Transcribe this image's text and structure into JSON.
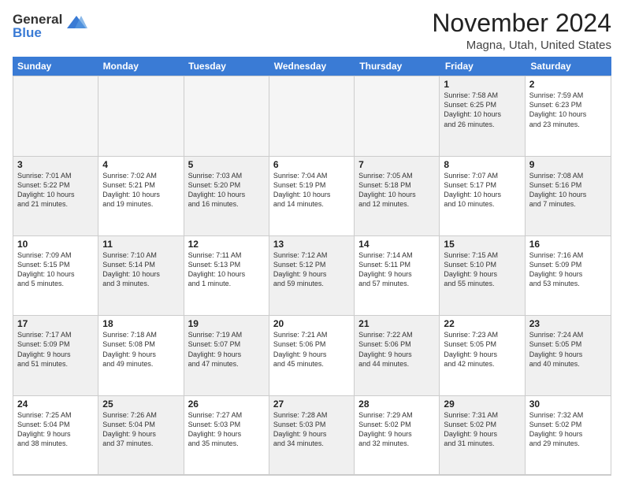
{
  "header": {
    "logo_line1": "General",
    "logo_line2": "Blue",
    "month_title": "November 2024",
    "location": "Magna, Utah, United States"
  },
  "weekdays": [
    "Sunday",
    "Monday",
    "Tuesday",
    "Wednesday",
    "Thursday",
    "Friday",
    "Saturday"
  ],
  "weeks": [
    [
      {
        "day": "",
        "detail": "",
        "empty": true
      },
      {
        "day": "",
        "detail": "",
        "empty": true
      },
      {
        "day": "",
        "detail": "",
        "empty": true
      },
      {
        "day": "",
        "detail": "",
        "empty": true
      },
      {
        "day": "",
        "detail": "",
        "empty": true
      },
      {
        "day": "1",
        "detail": "Sunrise: 7:58 AM\nSunset: 6:25 PM\nDaylight: 10 hours\nand 26 minutes.",
        "shaded": true
      },
      {
        "day": "2",
        "detail": "Sunrise: 7:59 AM\nSunset: 6:23 PM\nDaylight: 10 hours\nand 23 minutes.",
        "shaded": false
      }
    ],
    [
      {
        "day": "3",
        "detail": "Sunrise: 7:01 AM\nSunset: 5:22 PM\nDaylight: 10 hours\nand 21 minutes.",
        "shaded": true
      },
      {
        "day": "4",
        "detail": "Sunrise: 7:02 AM\nSunset: 5:21 PM\nDaylight: 10 hours\nand 19 minutes.",
        "shaded": false
      },
      {
        "day": "5",
        "detail": "Sunrise: 7:03 AM\nSunset: 5:20 PM\nDaylight: 10 hours\nand 16 minutes.",
        "shaded": true
      },
      {
        "day": "6",
        "detail": "Sunrise: 7:04 AM\nSunset: 5:19 PM\nDaylight: 10 hours\nand 14 minutes.",
        "shaded": false
      },
      {
        "day": "7",
        "detail": "Sunrise: 7:05 AM\nSunset: 5:18 PM\nDaylight: 10 hours\nand 12 minutes.",
        "shaded": true
      },
      {
        "day": "8",
        "detail": "Sunrise: 7:07 AM\nSunset: 5:17 PM\nDaylight: 10 hours\nand 10 minutes.",
        "shaded": false
      },
      {
        "day": "9",
        "detail": "Sunrise: 7:08 AM\nSunset: 5:16 PM\nDaylight: 10 hours\nand 7 minutes.",
        "shaded": true
      }
    ],
    [
      {
        "day": "10",
        "detail": "Sunrise: 7:09 AM\nSunset: 5:15 PM\nDaylight: 10 hours\nand 5 minutes.",
        "shaded": false
      },
      {
        "day": "11",
        "detail": "Sunrise: 7:10 AM\nSunset: 5:14 PM\nDaylight: 10 hours\nand 3 minutes.",
        "shaded": true
      },
      {
        "day": "12",
        "detail": "Sunrise: 7:11 AM\nSunset: 5:13 PM\nDaylight: 10 hours\nand 1 minute.",
        "shaded": false
      },
      {
        "day": "13",
        "detail": "Sunrise: 7:12 AM\nSunset: 5:12 PM\nDaylight: 9 hours\nand 59 minutes.",
        "shaded": true
      },
      {
        "day": "14",
        "detail": "Sunrise: 7:14 AM\nSunset: 5:11 PM\nDaylight: 9 hours\nand 57 minutes.",
        "shaded": false
      },
      {
        "day": "15",
        "detail": "Sunrise: 7:15 AM\nSunset: 5:10 PM\nDaylight: 9 hours\nand 55 minutes.",
        "shaded": true
      },
      {
        "day": "16",
        "detail": "Sunrise: 7:16 AM\nSunset: 5:09 PM\nDaylight: 9 hours\nand 53 minutes.",
        "shaded": false
      }
    ],
    [
      {
        "day": "17",
        "detail": "Sunrise: 7:17 AM\nSunset: 5:09 PM\nDaylight: 9 hours\nand 51 minutes.",
        "shaded": true
      },
      {
        "day": "18",
        "detail": "Sunrise: 7:18 AM\nSunset: 5:08 PM\nDaylight: 9 hours\nand 49 minutes.",
        "shaded": false
      },
      {
        "day": "19",
        "detail": "Sunrise: 7:19 AM\nSunset: 5:07 PM\nDaylight: 9 hours\nand 47 minutes.",
        "shaded": true
      },
      {
        "day": "20",
        "detail": "Sunrise: 7:21 AM\nSunset: 5:06 PM\nDaylight: 9 hours\nand 45 minutes.",
        "shaded": false
      },
      {
        "day": "21",
        "detail": "Sunrise: 7:22 AM\nSunset: 5:06 PM\nDaylight: 9 hours\nand 44 minutes.",
        "shaded": true
      },
      {
        "day": "22",
        "detail": "Sunrise: 7:23 AM\nSunset: 5:05 PM\nDaylight: 9 hours\nand 42 minutes.",
        "shaded": false
      },
      {
        "day": "23",
        "detail": "Sunrise: 7:24 AM\nSunset: 5:05 PM\nDaylight: 9 hours\nand 40 minutes.",
        "shaded": true
      }
    ],
    [
      {
        "day": "24",
        "detail": "Sunrise: 7:25 AM\nSunset: 5:04 PM\nDaylight: 9 hours\nand 38 minutes.",
        "shaded": false
      },
      {
        "day": "25",
        "detail": "Sunrise: 7:26 AM\nSunset: 5:04 PM\nDaylight: 9 hours\nand 37 minutes.",
        "shaded": true
      },
      {
        "day": "26",
        "detail": "Sunrise: 7:27 AM\nSunset: 5:03 PM\nDaylight: 9 hours\nand 35 minutes.",
        "shaded": false
      },
      {
        "day": "27",
        "detail": "Sunrise: 7:28 AM\nSunset: 5:03 PM\nDaylight: 9 hours\nand 34 minutes.",
        "shaded": true
      },
      {
        "day": "28",
        "detail": "Sunrise: 7:29 AM\nSunset: 5:02 PM\nDaylight: 9 hours\nand 32 minutes.",
        "shaded": false
      },
      {
        "day": "29",
        "detail": "Sunrise: 7:31 AM\nSunset: 5:02 PM\nDaylight: 9 hours\nand 31 minutes.",
        "shaded": true
      },
      {
        "day": "30",
        "detail": "Sunrise: 7:32 AM\nSunset: 5:02 PM\nDaylight: 9 hours\nand 29 minutes.",
        "shaded": false
      }
    ]
  ]
}
